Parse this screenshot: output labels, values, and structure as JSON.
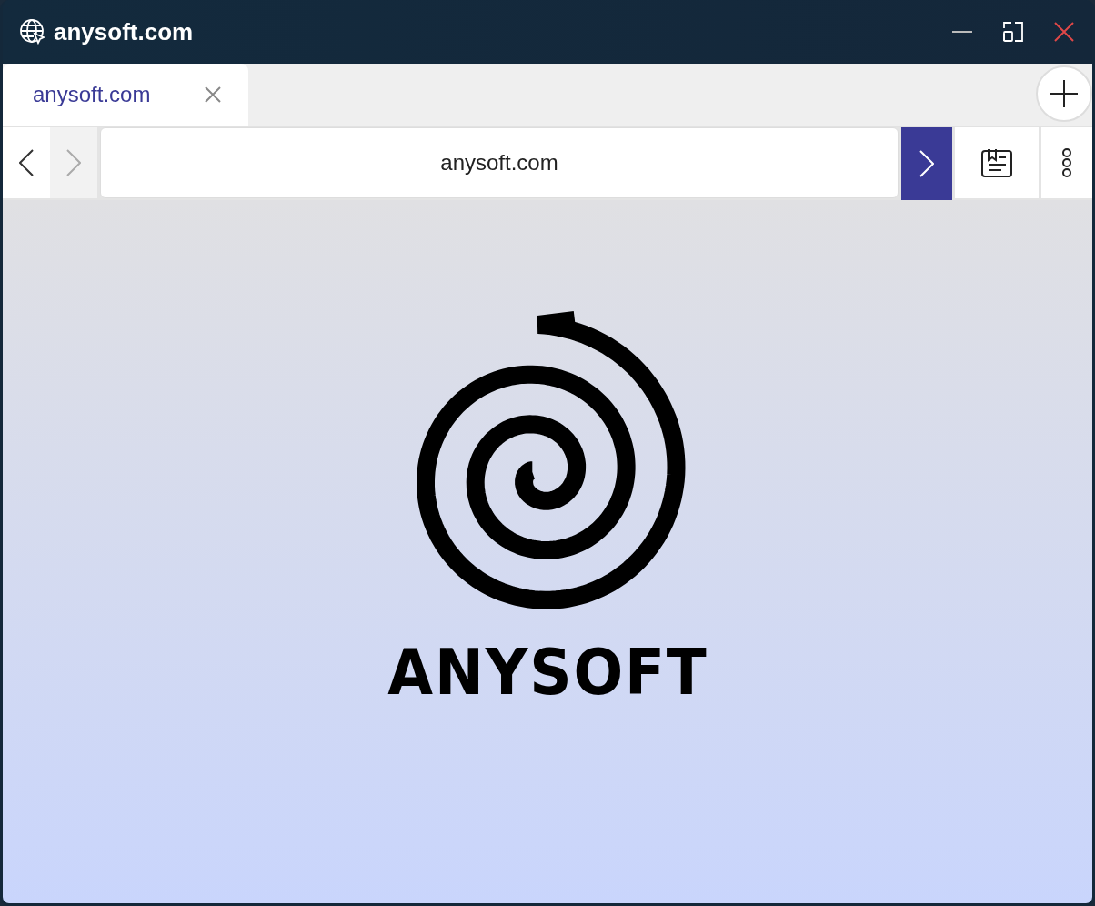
{
  "window": {
    "title": "anysoft.com"
  },
  "tabs": [
    {
      "label": "anysoft.com",
      "selected": true
    }
  ],
  "nav": {
    "back_disabled": false,
    "forward_disabled": true
  },
  "address_bar": {
    "value": "anysoft.com"
  },
  "page": {
    "logo_text": "ANYSOFT"
  }
}
